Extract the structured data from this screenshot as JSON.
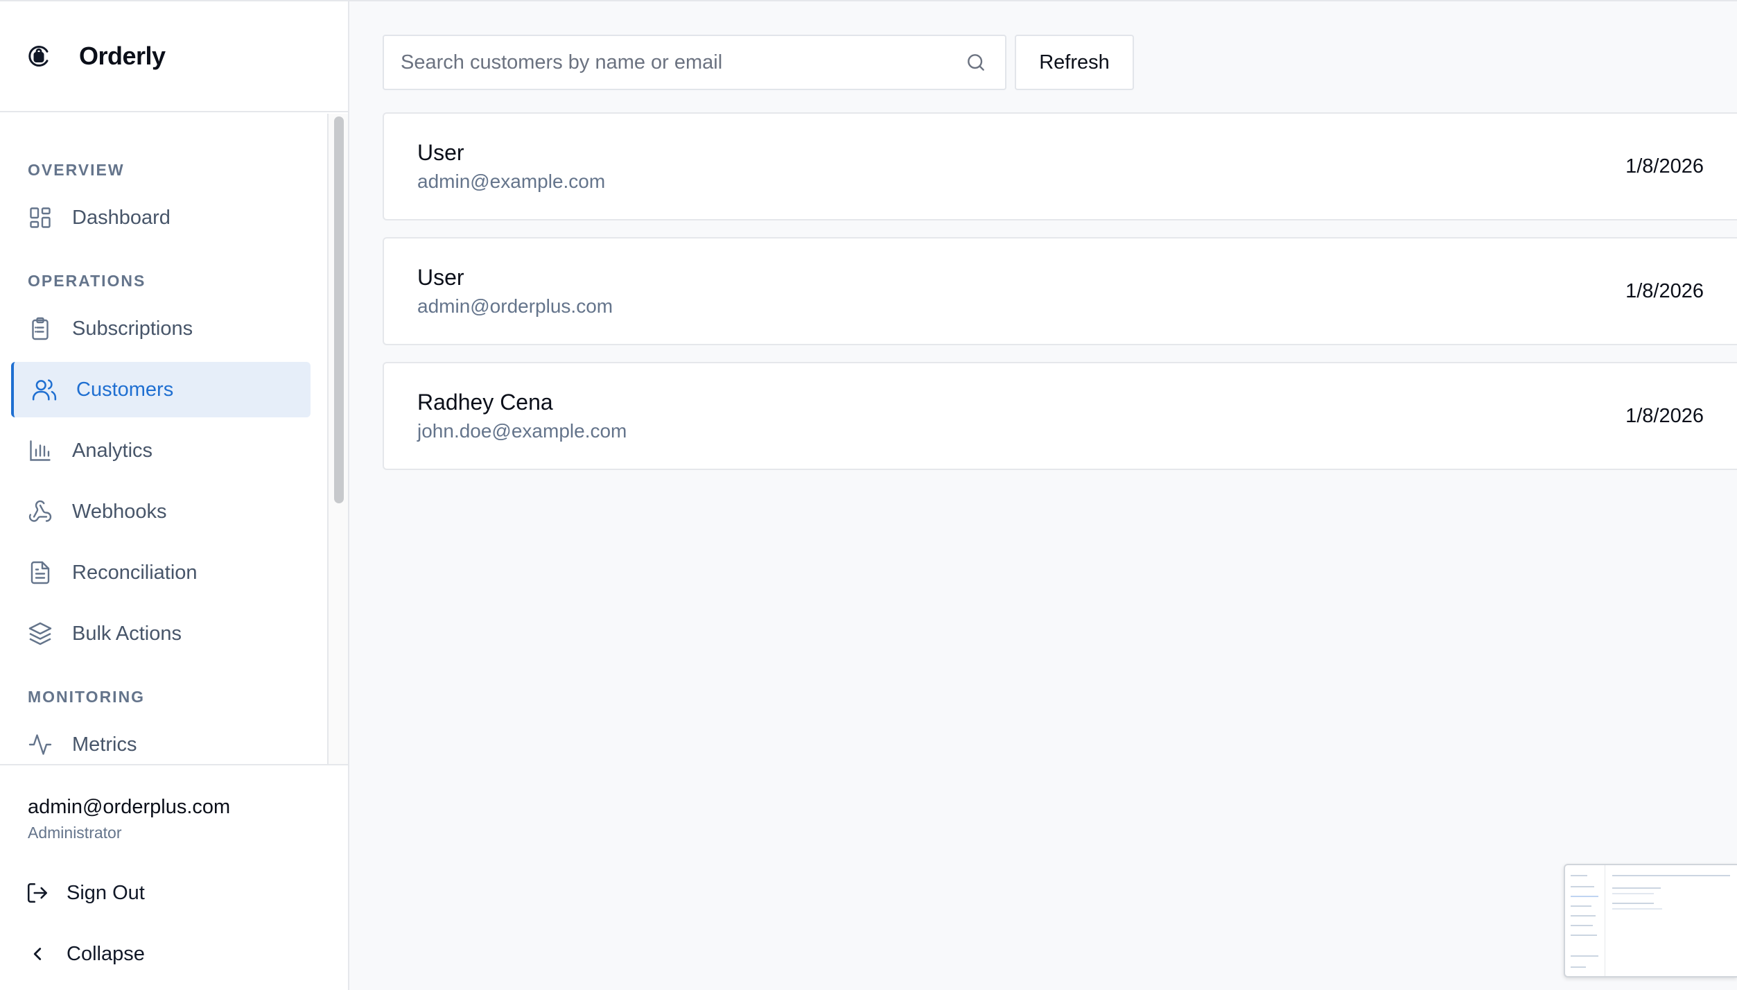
{
  "app": {
    "name": "Orderly"
  },
  "sidebar": {
    "sections": {
      "overview": "OVERVIEW",
      "operations": "OPERATIONS",
      "monitoring": "MONITORING"
    },
    "items": [
      {
        "label": "Dashboard",
        "icon": "dashboard-grid-icon"
      },
      {
        "label": "Subscriptions",
        "icon": "clipboard-list-icon"
      },
      {
        "label": "Customers",
        "icon": "users-icon",
        "active": true
      },
      {
        "label": "Analytics",
        "icon": "bar-chart-icon"
      },
      {
        "label": "Webhooks",
        "icon": "webhook-icon"
      },
      {
        "label": "Reconciliation",
        "icon": "file-text-icon"
      },
      {
        "label": "Bulk Actions",
        "icon": "layers-icon"
      },
      {
        "label": "Metrics",
        "icon": "activity-icon"
      }
    ],
    "user": {
      "email": "admin@orderplus.com",
      "role": "Administrator"
    },
    "sign_out": "Sign Out",
    "collapse": "Collapse"
  },
  "search": {
    "placeholder": "Search customers by name or email",
    "value": ""
  },
  "toolbar": {
    "refresh_label": "Refresh"
  },
  "customers": [
    {
      "name": "User",
      "email": "admin@example.com",
      "date": "1/8/2026"
    },
    {
      "name": "User",
      "email": "admin@orderplus.com",
      "date": "1/8/2026"
    },
    {
      "name": "Radhey Cena",
      "email": "john.doe@example.com",
      "date": "1/8/2026"
    }
  ],
  "colors": {
    "accent": "#1f6fd1",
    "active_bg": "#e6eef9",
    "muted_text": "#64748b",
    "background": "#f8f9fb"
  }
}
